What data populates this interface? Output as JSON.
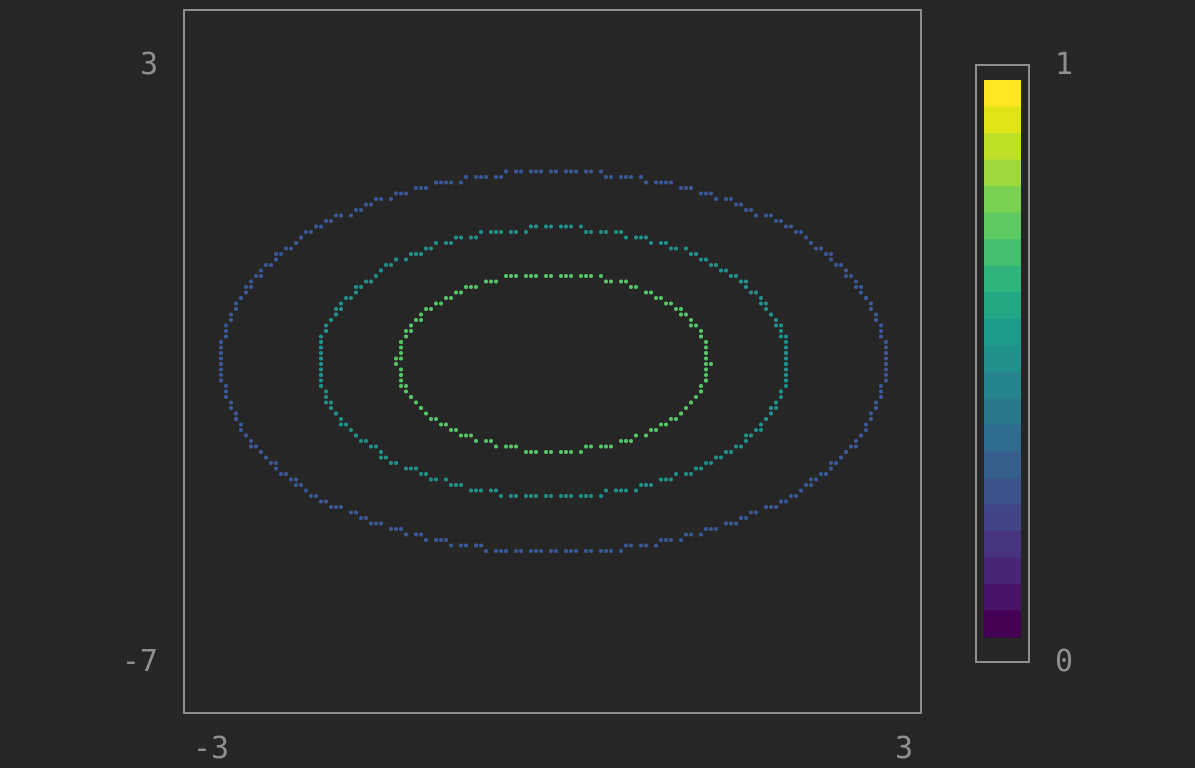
{
  "chart_data": {
    "type": "contour",
    "function_note": "",
    "x_range": [
      -3,
      3
    ],
    "y_range": [
      -7,
      3
    ],
    "x_ticks": [
      "-3",
      "3"
    ],
    "y_ticks": [
      "3",
      "-7"
    ],
    "colorbar": {
      "min": 0,
      "max": 1,
      "tick_labels": [
        "1",
        "0"
      ],
      "colormap": [
        "#440154",
        "#481467",
        "#482576",
        "#463480",
        "#414487",
        "#3b528b",
        "#355f8d",
        "#2f6c8e",
        "#2a788e",
        "#25848e",
        "#21918c",
        "#1e9c89",
        "#22a884",
        "#2fb47c",
        "#44bf70",
        "#5ec962",
        "#7ad151",
        "#9bd93c",
        "#bddf26",
        "#dfe318",
        "#fde725"
      ]
    },
    "series": [
      {
        "level": 0.65,
        "radius": 1.27,
        "color": "#55c667"
      },
      {
        "level": 0.5,
        "radius": 1.92,
        "color": "#21918c"
      },
      {
        "level": 0.3,
        "radius": 2.72,
        "color": "#3b5998"
      }
    ],
    "center": [
      0,
      -2
    ],
    "grid": false
  }
}
